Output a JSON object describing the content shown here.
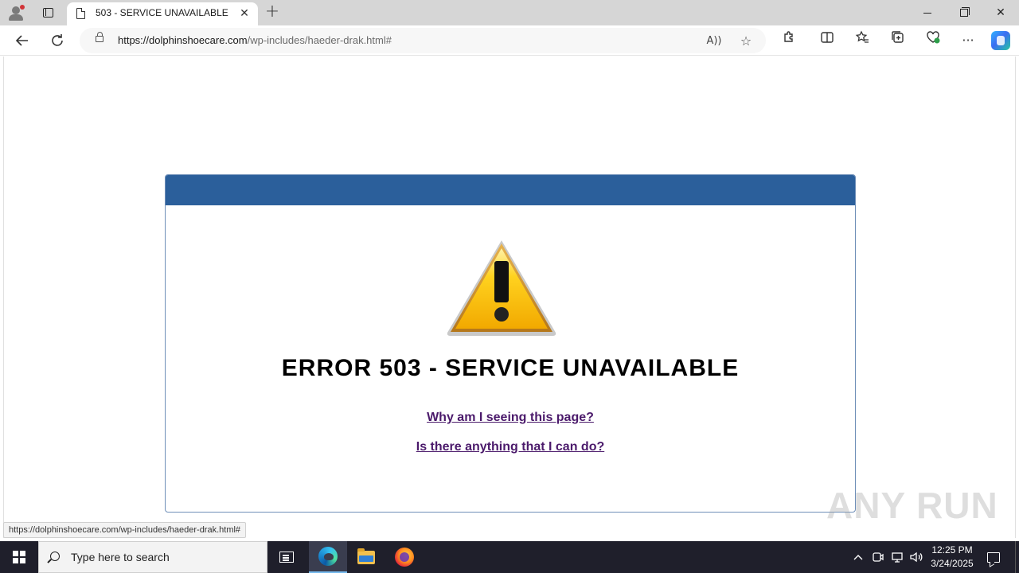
{
  "browser": {
    "tab": {
      "title": "503 - SERVICE UNAVAILABLE",
      "icon": "page-icon"
    },
    "new_tab_icon": "plus-icon",
    "window_controls": [
      "minimize-icon",
      "restore-icon",
      "close-icon"
    ],
    "address": {
      "url_host": "https://dolphinshoecare.com",
      "url_path": "/wp-includes/haeder-drak.html#"
    },
    "toolbar_icons": [
      "read-aloud-icon",
      "favorite-star-icon",
      "extensions-icon",
      "split-screen-icon",
      "favorites-icon",
      "collections-icon",
      "browser-essentials-icon",
      "more-icon",
      "copilot-icon"
    ]
  },
  "page": {
    "header_color": "#2b5f9b",
    "title": "ERROR 503 - SERVICE UNAVAILABLE",
    "links": [
      "Why am I seeing this page?",
      "Is there anything that I can do?"
    ],
    "link_color": "#4b1a6b",
    "warning_icon": "warning-triangle-icon"
  },
  "status_bar": {
    "hover_url": "https://dolphinshoecare.com/wp-includes/haeder-drak.html#"
  },
  "watermark": "ANY RUN",
  "taskbar": {
    "search_placeholder": "Type here to search",
    "apps": [
      "task-view-icon",
      "edge-icon",
      "file-explorer-icon",
      "firefox-icon"
    ],
    "clock": {
      "time": "12:25 PM",
      "date": "3/24/2025"
    }
  }
}
